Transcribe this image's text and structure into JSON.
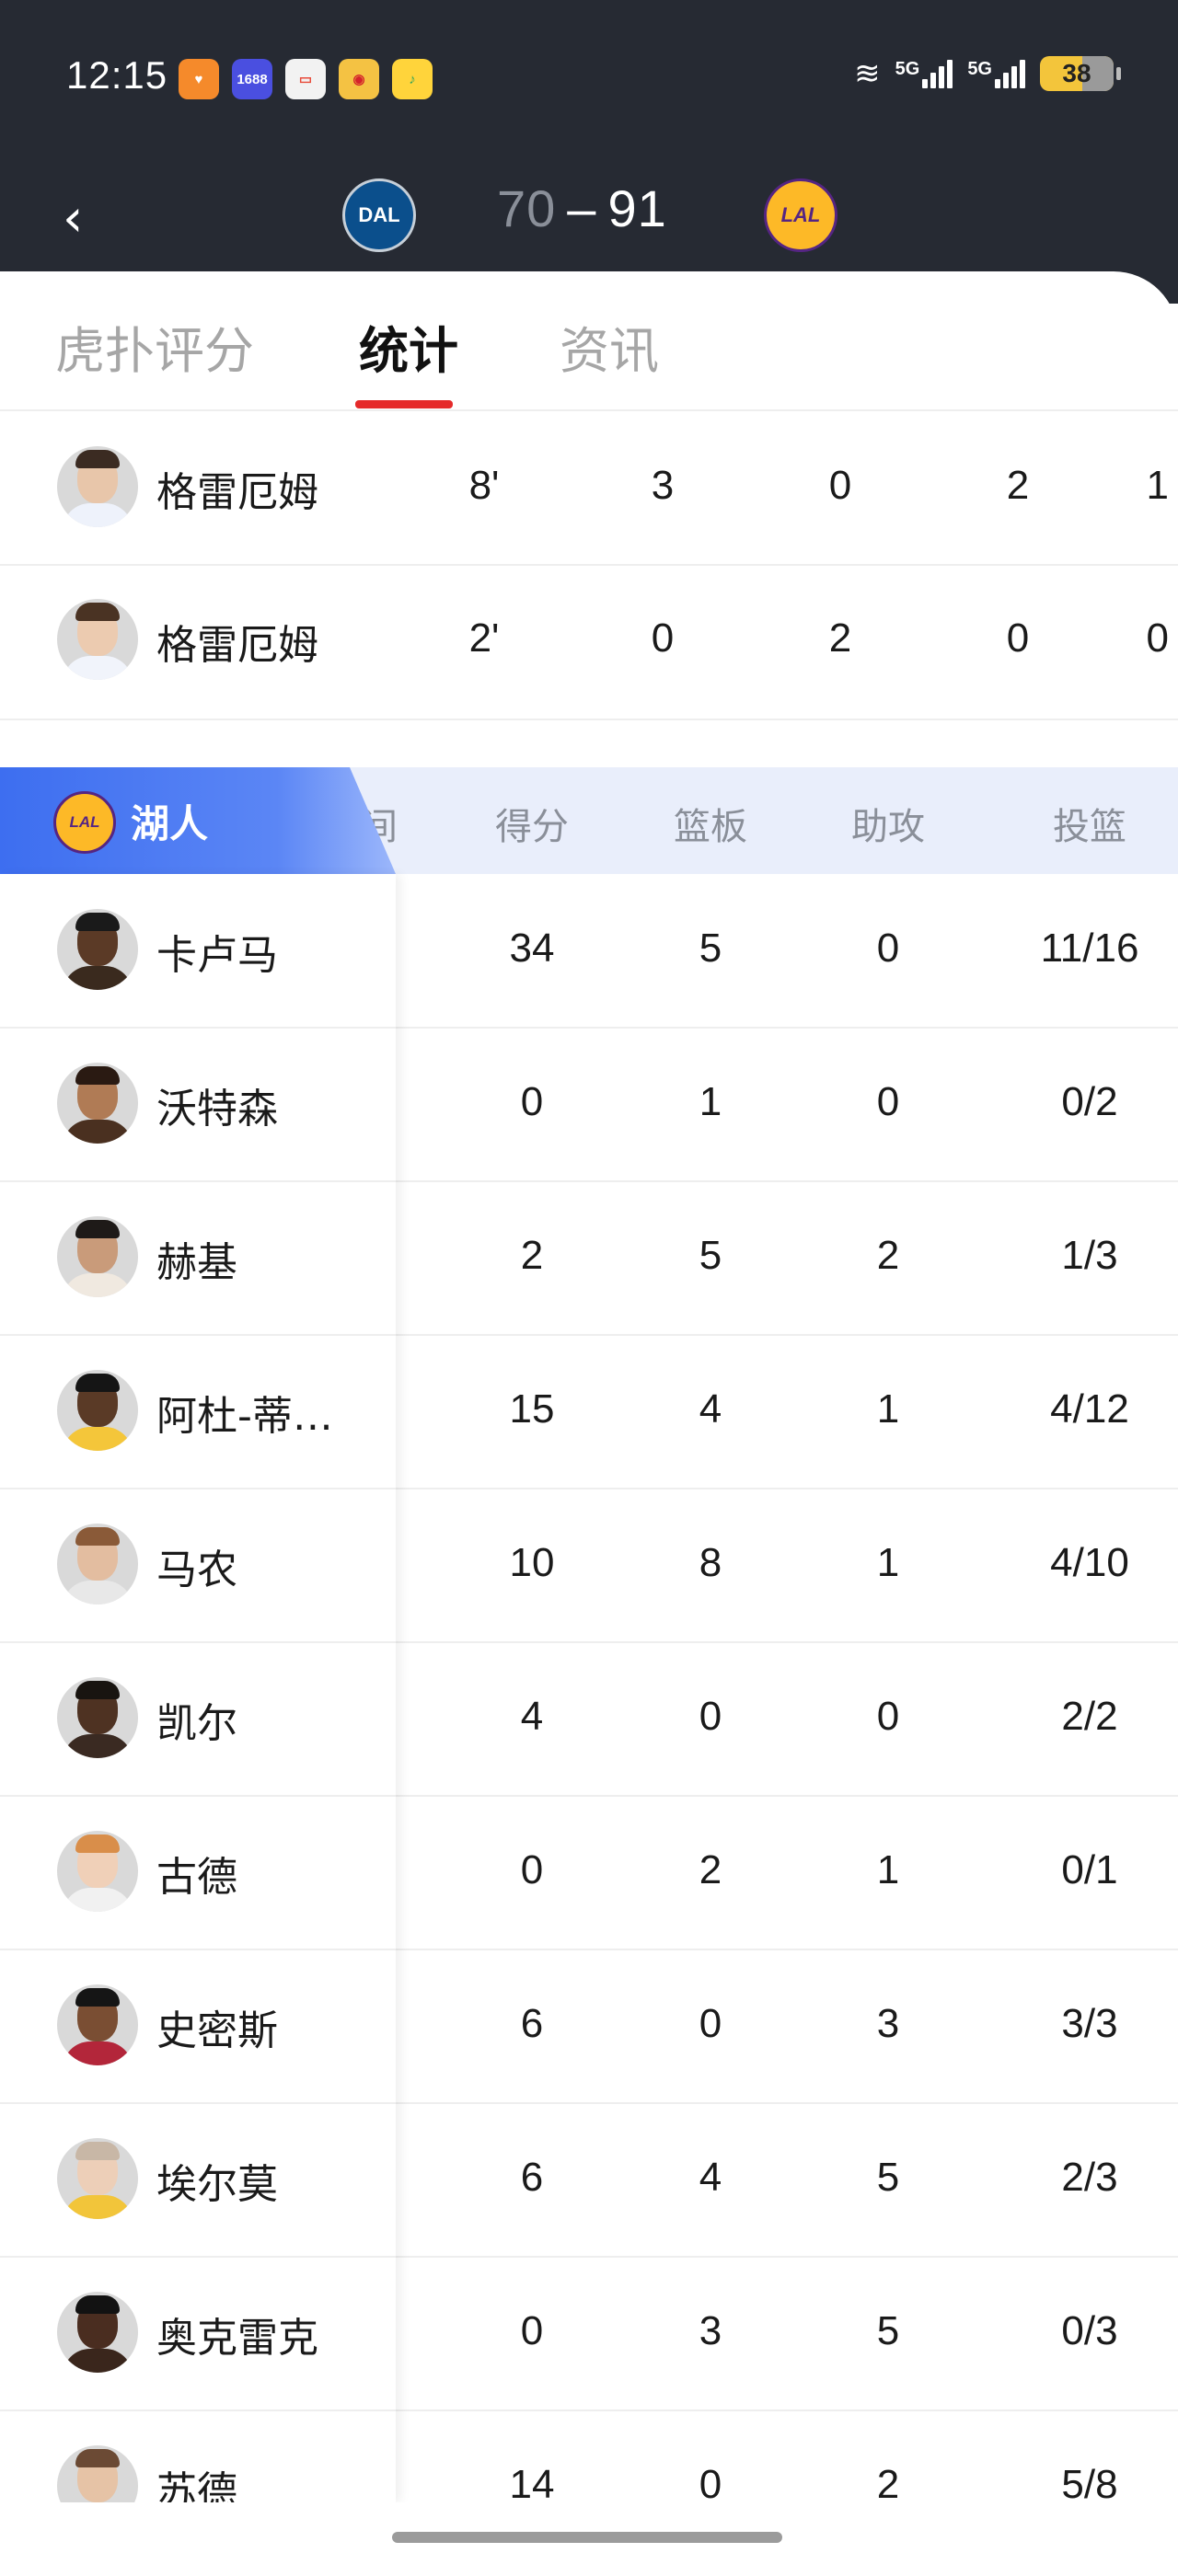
{
  "status_bar": {
    "time": "12:15",
    "apps": [
      {
        "icon": "heart-app-icon",
        "label": "",
        "color": "#f58a2b"
      },
      {
        "icon": "app-1688-icon",
        "label": "1688",
        "color": "#4a4fe0"
      },
      {
        "icon": "wallet-app-icon",
        "label": "",
        "color": "#f2f2f2"
      },
      {
        "icon": "weibo-icon",
        "label": "",
        "color": "#f4c243"
      },
      {
        "icon": "music-app-icon",
        "label": "",
        "color": "#ffd43b"
      }
    ],
    "network_1": "5G",
    "network_2": "5G",
    "battery": "38"
  },
  "game": {
    "away_team": "DAL",
    "home_team": "LAL",
    "away_score": "70",
    "separator": "–",
    "home_score": "91"
  },
  "tabs": [
    {
      "label": "虎扑评分",
      "active": false
    },
    {
      "label": "统计",
      "active": true
    },
    {
      "label": "资讯",
      "active": false
    }
  ],
  "mavs_rows": [
    {
      "name": "格雷厄姆",
      "time": "8'",
      "pts": "3",
      "reb": "0",
      "ast": "2",
      "extra": "1"
    },
    {
      "name": "格雷厄姆",
      "time": "2'",
      "pts": "0",
      "reb": "2",
      "ast": "0",
      "extra": "0"
    }
  ],
  "lakers": {
    "team_name": "湖人",
    "headers": {
      "time_partial": "间",
      "pts": "得分",
      "reb": "篮板",
      "ast": "助攻",
      "fg": "投篮"
    },
    "players": [
      {
        "name": "卡卢马",
        "pts": "34",
        "reb": "5",
        "ast": "0",
        "fg": "11/16"
      },
      {
        "name": "沃特森",
        "pts": "0",
        "reb": "1",
        "ast": "0",
        "fg": "0/2"
      },
      {
        "name": "赫基",
        "pts": "2",
        "reb": "5",
        "ast": "2",
        "fg": "1/3"
      },
      {
        "name": "阿杜-蒂…",
        "pts": "15",
        "reb": "4",
        "ast": "1",
        "fg": "4/12"
      },
      {
        "name": "马农",
        "pts": "10",
        "reb": "8",
        "ast": "1",
        "fg": "4/10"
      },
      {
        "name": "凯尔",
        "pts": "4",
        "reb": "0",
        "ast": "0",
        "fg": "2/2"
      },
      {
        "name": "古德",
        "pts": "0",
        "reb": "2",
        "ast": "1",
        "fg": "0/1"
      },
      {
        "name": "史密斯",
        "pts": "6",
        "reb": "0",
        "ast": "3",
        "fg": "3/3"
      },
      {
        "name": "埃尔莫",
        "pts": "6",
        "reb": "4",
        "ast": "5",
        "fg": "2/3"
      },
      {
        "name": "奥克雷克",
        "pts": "0",
        "reb": "3",
        "ast": "5",
        "fg": "0/3"
      },
      {
        "name": "苏德",
        "pts": "14",
        "reb": "0",
        "ast": "2",
        "fg": "5/8"
      }
    ]
  }
}
